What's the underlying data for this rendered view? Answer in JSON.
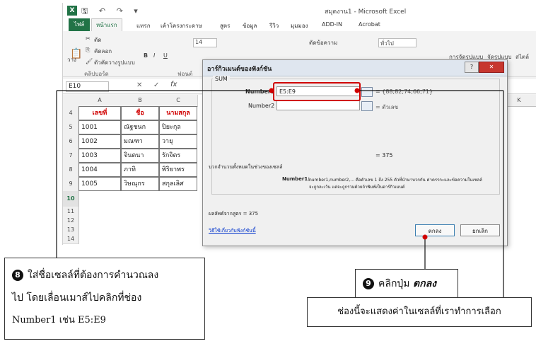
{
  "excel": {
    "title": "สมุดงาน1 - Microsoft Excel",
    "tabs": [
      "ไฟล์",
      "หน้าแรก",
      "แทรก",
      "เค้าโครงกระดาษ",
      "สูตร",
      "ข้อมูล",
      "รีวิว",
      "มุมมอง",
      "ADD-IN",
      "Acrobat"
    ],
    "ribbon": {
      "cut": "ตัด",
      "copy": "คัดลอก",
      "format_painter": "ตัวคัดวางรูปแบบ",
      "paste": "วาง",
      "clipboard_group": "คลิปบอร์ด",
      "font_group": "ฟอนต์",
      "font_size": "14",
      "bold": "B",
      "italic": "I",
      "underline": "U",
      "wrap_text": "ตัดข้อความ",
      "number_format": "ทั่วไป",
      "conditional": "การจัดรูปแบบ",
      "format_table": "จัดรูปแบบ",
      "cell_style": "สไตล์"
    },
    "name_box": "E10",
    "columns": [
      "A",
      "B",
      "C",
      "K"
    ],
    "row_numbers": [
      "4",
      "5",
      "6",
      "7",
      "8",
      "9",
      "10",
      "11",
      "12",
      "13",
      "14"
    ],
    "headers": [
      "เลขที่",
      "ชื่อ",
      "นามสกุล"
    ],
    "rows": [
      [
        "1001",
        "ณัฐชนก",
        "ปิยะกุล"
      ],
      [
        "1002",
        "มณฑา",
        "วายุ"
      ],
      [
        "1003",
        "จินตนา",
        "รักจิตร"
      ],
      [
        "1004",
        "ภาทิ",
        "พิริยาพร"
      ],
      [
        "1005",
        "วิษณุกร",
        "สกุลเลิศ"
      ]
    ]
  },
  "dialog": {
    "title": "อาร์กิวเมนต์ของฟังก์ชัน",
    "function_name": "SUM",
    "number1_label": "Number1",
    "number1_value": "E5:E9",
    "number1_result": "= {88;82;74;66;71}",
    "number2_label": "Number2",
    "number2_result": "= ตัวเลข",
    "total_result": "= 375",
    "description": "บวกจำนวนทั้งหมดในช่วงของเซลล์",
    "arg_name": "Number1:",
    "arg_help_line1": "number1,number2,... คือตัวเลข 1 ถึง 255 ตัวที่นำมาบวกกัน ค่าตรรกะและข้อความในเซลล์",
    "arg_help_line2": "จะถูกละเว้น แต่จะถูกรวมด้วยถ้าพิมพ์เป็นอาร์กิวเมนต์",
    "formula_result": "ผลลัพธ์จากสูตร = 375",
    "help_link": "วิธีใช้เกี่ยวกับฟังก์ชันนี้",
    "ok_label": "ตกลง",
    "cancel_label": "ยกเลิก",
    "help_btn": "?",
    "close_btn": "✕"
  },
  "callouts": {
    "step8_number": "8",
    "step8_line1": "ใส่ชื่อเซลล์ที่ต้องการคำนวณลง",
    "step8_line2": "ไป  โดยเลื่อนเมาส์ไปคลิกที่ช่อง",
    "step8_line3": "Number1  เช่น E5:E9",
    "step9_number": "9",
    "step9_text": "คลิกปุ่ม",
    "step9_bold": "ตกลง",
    "step_result": "ช่องนี้จะแสดงค่าในเซลล์ที่เราทำการเลือก"
  },
  "colors": {
    "excel_green": "#217346",
    "header_red": "#d00000",
    "highlight_red": "#d00000",
    "link_blue": "#0033cc"
  }
}
